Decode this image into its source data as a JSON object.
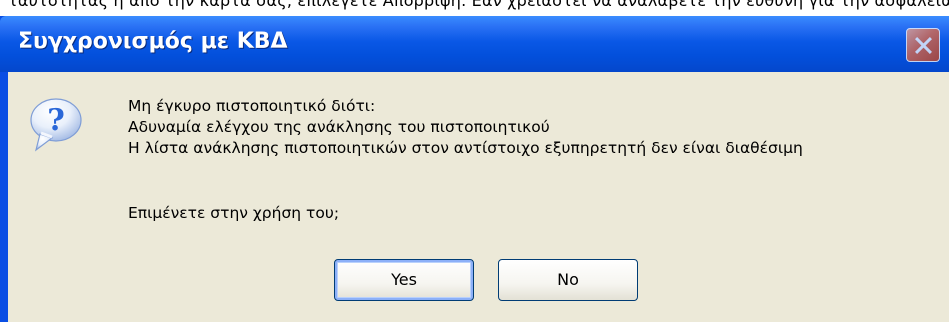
{
  "background_text": "ταυτότητας ή από την κάρτα σας, επιλέγετε Απόρριψη. Εάν χρειαστεί να αναλάβετε την ευθύνη για την ασφάλεια της επικοινωνίας σας",
  "dialog": {
    "title": "Συγχρονισμός με ΚΒΔ",
    "icon": "question-icon",
    "message_lines": [
      "Μη έγκυρο πιστοποιητικό διότι:",
      "Αδυναμία ελέγχου της ανάκλησης του πιστοποιητικού",
      "Η λίστα ανάκλησης πιστοποιητικών στον αντίστοιχο εξυπηρετητή δεν είναι διαθέσιμη"
    ],
    "question": "Επιμένετε στην χρήση του;",
    "buttons": {
      "yes": "Yes",
      "no": "No"
    }
  },
  "colors": {
    "titlebar": "#0350dc",
    "client": "#ece9d8",
    "icon": "#2a67d8"
  }
}
